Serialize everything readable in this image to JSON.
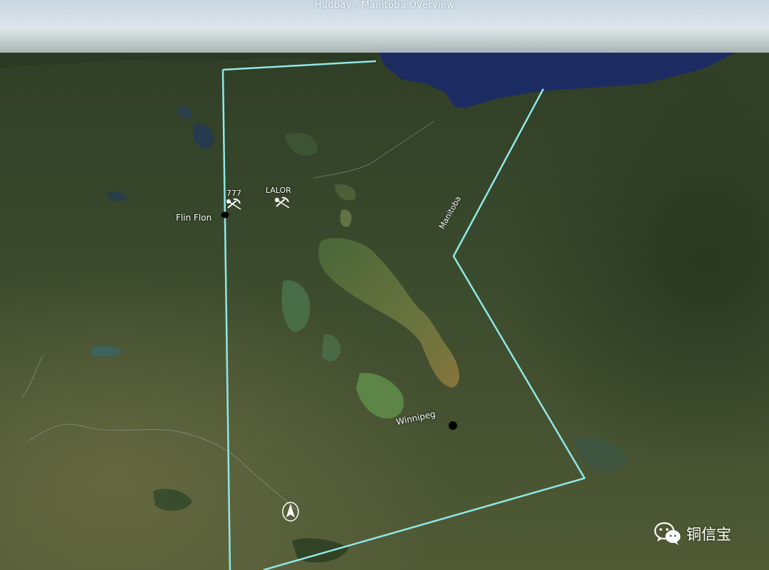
{
  "map": {
    "title": "Hudbay - Manitoba Overview",
    "province_label": "Manitoba",
    "colors": {
      "boundary": "#8fe8e6",
      "water_bay": "#1a2a5e",
      "land": "#3f4f2c"
    },
    "places": [
      {
        "label": "Flin Flon",
        "type": "city"
      },
      {
        "label": "Winnipeg",
        "type": "city"
      }
    ],
    "mines": [
      {
        "label": "777",
        "icon": "mine-pick-icon"
      },
      {
        "label": "LALOR",
        "icon": "mine-pick-icon"
      }
    ],
    "compass_icon": "north-arrow-icon"
  },
  "watermark": {
    "text": "铜信宝",
    "icon": "wechat-icon"
  }
}
